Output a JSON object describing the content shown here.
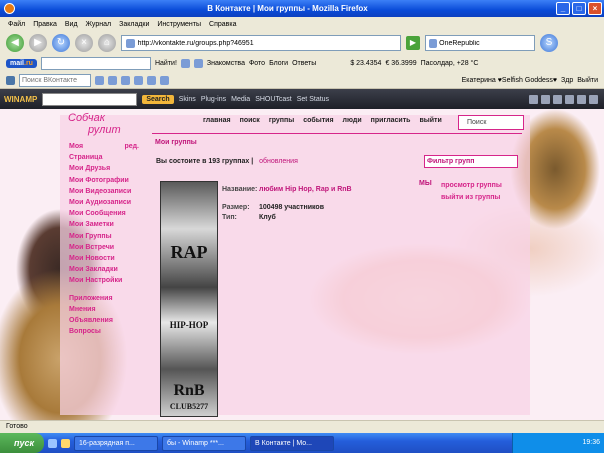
{
  "window": {
    "title": "В Контакте | Мои группы - Mozilla Firefox"
  },
  "menu": [
    "Файл",
    "Правка",
    "Вид",
    "Журнал",
    "Закладки",
    "Инструменты",
    "Справка"
  ],
  "nav": {
    "url": "http://vkontakte.ru/groups.php?46951",
    "search_value": "OneRepublic"
  },
  "mailbar": {
    "brand": "mail.ru",
    "find": "Найти!",
    "links": [
      "Знакомства",
      "Фото",
      "Блоги",
      "Ответы"
    ],
    "usd": "$ 23.4354",
    "eur": "€ 36.3999",
    "weather": "Пасолдар, +28 °С"
  },
  "vkbar": {
    "search_placeholder": "Поиск ВКонтакте",
    "user": "Екатерина ♥Selfish Goddess♥",
    "home": "Здр",
    "logout": "Выйти"
  },
  "winamp": {
    "logo": "WINAMP",
    "search": "Search",
    "menus": [
      "Skins",
      "Plug-ins",
      "Media",
      "SHOUTcast",
      "Set Status"
    ]
  },
  "page": {
    "logo_line1": "Собчак",
    "logo_line2": "рулит",
    "topnav": [
      "главная",
      "поиск",
      "группы",
      "события",
      "люди",
      "пригласить",
      "выйти"
    ],
    "search_box": "Поиск",
    "title": "Мои группы",
    "summary": "Вы состоите в 193 группах",
    "update": "обновления",
    "filter": "Фильтр групп",
    "sidebar": {
      "my": "Моя",
      "edit": "ред.",
      "page": "Страница",
      "items": [
        "Мои Друзья",
        "Мои Фотографии",
        "Мои Видеозаписи",
        "Мои Аудиозаписи",
        "Мои Сообщения",
        "Мои Заметки",
        "Мои Группы",
        "Мои Встречи",
        "Мои Новости",
        "Мои Закладки",
        "Мои Настройки"
      ],
      "extras": [
        "Приложения",
        "Мнения",
        "Объявления",
        "Вопросы"
      ]
    },
    "group": {
      "image_text": [
        "RAP",
        "HIP-HOP",
        "RnB",
        "CLUB5277"
      ],
      "name_label": "Название:",
      "name": "любим Hip Hop, Rap и RnB",
      "size_label": "Размер:",
      "size": "100498 участников",
      "type_label": "Тип:",
      "type": "Клуб",
      "my": "МЫ",
      "actions": [
        "просмотр группы",
        "выйти из группы"
      ]
    }
  },
  "status": "Готово",
  "taskbar": {
    "start": "пуск",
    "tasks": [
      "16-разрядная п...",
      "бы - Winamp ***...",
      "В Контакте | Мо..."
    ],
    "clock": "19:36"
  }
}
